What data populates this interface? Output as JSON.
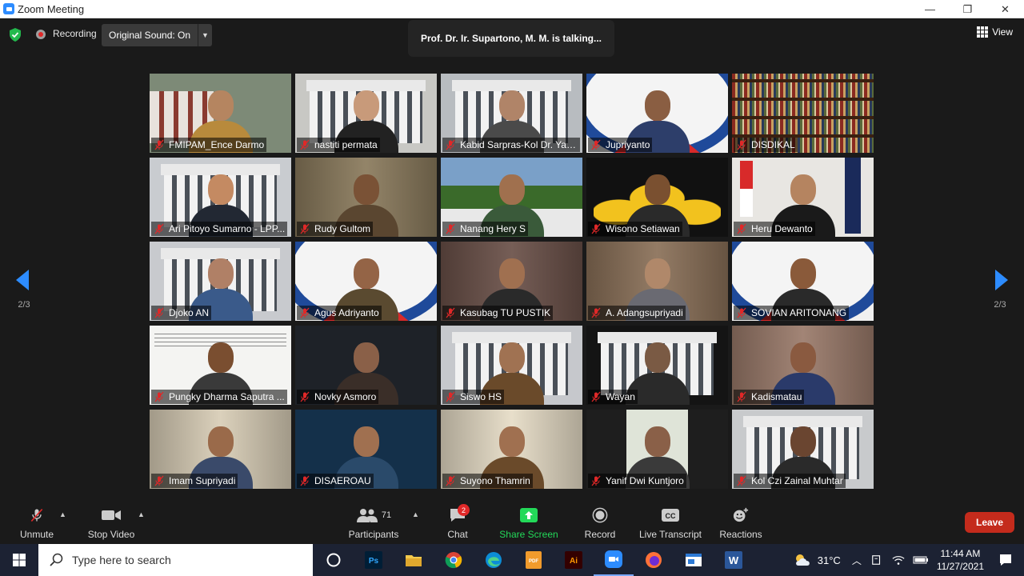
{
  "window": {
    "title": "Zoom Meeting",
    "controls": [
      "—",
      "❐",
      "✕"
    ]
  },
  "topbar": {
    "recording_label": "Recording",
    "original_sound_label": "Original Sound: On",
    "talking_banner": "Prof. Dr. Ir. Supartono, M. M. is talking...",
    "view_label": "View"
  },
  "pager": {
    "left_page": "2/3",
    "right_page": "2/3"
  },
  "participants": [
    {
      "name": "FMIPAM_Ence Darmo",
      "bg": "#7d8a77",
      "shirt": "#b88a3c",
      "skin": "#b58560",
      "scene": "campus"
    },
    {
      "name": "nastiti permata",
      "bg": "#c8c8c4",
      "shirt": "#222222",
      "skin": "#c89a7a",
      "scene": "building"
    },
    {
      "name": "Kabid Sarpras-Kol Dr. Yan...",
      "bg": "#b8bcc0",
      "shirt": "#4a4a4a",
      "skin": "#b08468",
      "scene": "building"
    },
    {
      "name": "Jupriyanto",
      "bg": "#f2f2f2",
      "shirt": "#2d3e6a",
      "skin": "#8a5e42",
      "scene": "emblem"
    },
    {
      "name": "DISDIKAL",
      "bg": "#6a3b24",
      "shirt": "#6a3b24",
      "skin": "#6a3b24",
      "scene": "books"
    },
    {
      "name": "Ari Pitoyo Sumarno - LPP...",
      "bg": "#c9ccd0",
      "shirt": "#222833",
      "skin": "#c48a62",
      "scene": "building"
    },
    {
      "name": "Rudy Gultom",
      "bg": "#8a7a5c",
      "shirt": "#5a4630",
      "skin": "#7a5236",
      "scene": "room"
    },
    {
      "name": "Nanang Hery S",
      "bg": "#7aa0c8",
      "shirt": "#3a5a3a",
      "skin": "#a0704e",
      "scene": "outdoor"
    },
    {
      "name": "Wisono Setiawan",
      "bg": "#111111",
      "shirt": "#2a2a2a",
      "skin": "#7a5030",
      "scene": "gold"
    },
    {
      "name": "Heru Dewanto",
      "bg": "#e8e6e2",
      "shirt": "#1a1a1a",
      "skin": "#b58460",
      "scene": "flag"
    },
    {
      "name": "Djoko AN",
      "bg": "#c8cace",
      "shirt": "#3a5a8a",
      "skin": "#b08066",
      "scene": "building"
    },
    {
      "name": "Agus Adriyanto",
      "bg": "#f0f0f0",
      "shirt": "#5a4a30",
      "skin": "#946446",
      "scene": "emblem"
    },
    {
      "name": "Kasubag TU PUSTIK",
      "bg": "#6a5048",
      "shirt": "#2a2a2a",
      "skin": "#a07050",
      "scene": "room"
    },
    {
      "name": "A. Adangsupriyadi",
      "bg": "#8a7058",
      "shirt": "#6a6a72",
      "skin": "#b0886a",
      "scene": "room"
    },
    {
      "name": "SOVIAN ARITONANG",
      "bg": "#f0f0f0",
      "shirt": "#2a2a2a",
      "skin": "#8a5a3a",
      "scene": "emblem"
    },
    {
      "name": "Pungky Dharma Saputra ...",
      "bg": "#f4f4f2",
      "shirt": "#3a3a3a",
      "skin": "#7a4e30",
      "scene": "document"
    },
    {
      "name": "Novky Asmoro",
      "bg": "#1e2228",
      "shirt": "#3a2e28",
      "skin": "#8a6048",
      "scene": "dark"
    },
    {
      "name": "Siswo HS",
      "bg": "#c6c8cc",
      "shirt": "#6a4a2a",
      "skin": "#a07252",
      "scene": "building"
    },
    {
      "name": "Wayan",
      "bg": "#141414",
      "shirt": "#2a2a2a",
      "skin": "#7a5a44",
      "scene": "building"
    },
    {
      "name": "Kadismatau",
      "bg": "#9a7a6a",
      "shirt": "#2a3a6a",
      "skin": "#8a5a40",
      "scene": "room"
    },
    {
      "name": "Imam Supriyadi",
      "bg": "#d8cdb6",
      "shirt": "#3a4a6a",
      "skin": "#9a6a4a",
      "scene": "room"
    },
    {
      "name": "DISAEROAU",
      "bg": "#14304a",
      "shirt": "#2a4a6a",
      "skin": "#a07050",
      "scene": "dark"
    },
    {
      "name": "Suyono Thamrin",
      "bg": "#e6dcc6",
      "shirt": "#6a4a2a",
      "skin": "#a07050",
      "scene": "room"
    },
    {
      "name": "Yanif Dwi Kuntjoro",
      "bg": "#1e1e1e",
      "shirt": "#3a3a3a",
      "skin": "#8a6048",
      "scene": "window"
    },
    {
      "name": "Kol Czi Zainal Muhtar",
      "bg": "#c8cacc",
      "shirt": "#2a2a2a",
      "skin": "#6a4530",
      "scene": "building"
    }
  ],
  "toolbar": {
    "unmute": "Unmute",
    "stop_video": "Stop Video",
    "participants": "Participants",
    "participants_count": "71",
    "chat": "Chat",
    "chat_badge": "2",
    "share_screen": "Share Screen",
    "record": "Record",
    "live_transcript": "Live Transcript",
    "reactions": "Reactions",
    "leave": "Leave",
    "accent_green": "#23d959",
    "leave_color": "#c42b1c"
  },
  "taskbar": {
    "search_placeholder": "Type here to search",
    "apps": [
      "cortana-icon",
      "photoshop-icon",
      "file-explorer-icon",
      "chrome-icon",
      "edge-icon",
      "pdf-icon",
      "illustrator-icon",
      "zoom-icon",
      "firefox-icon",
      "window-app-icon",
      "word-icon"
    ],
    "temperature": "31°C",
    "time": "11:44 AM",
    "date": "11/27/2021"
  }
}
